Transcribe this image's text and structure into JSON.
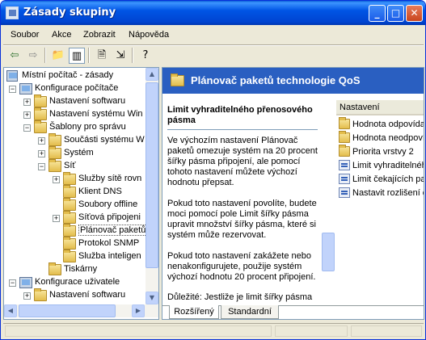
{
  "window": {
    "title": "Zásady skupiny"
  },
  "menu": [
    "Soubor",
    "Akce",
    "Zobrazit",
    "Nápověda"
  ],
  "tree": [
    {
      "label": "Místní počítač - zásady",
      "icon": "policy-icon"
    },
    {
      "label": "Konfigurace počítače",
      "icon": "computer-icon"
    },
    {
      "label": "Nastavení softwaru",
      "icon": "folder-icon"
    },
    {
      "label": "Nastavení systému Win",
      "icon": "folder-icon"
    },
    {
      "label": "Šablony pro správu",
      "icon": "folder-icon"
    },
    {
      "label": "Součásti systému W",
      "icon": "folder-icon"
    },
    {
      "label": "Systém",
      "icon": "folder-icon"
    },
    {
      "label": "Síť",
      "icon": "folder-open-icon"
    },
    {
      "label": "Služby sítě rovn",
      "icon": "folder-icon"
    },
    {
      "label": "Klient DNS",
      "icon": "folder-icon"
    },
    {
      "label": "Soubory offline",
      "icon": "folder-icon"
    },
    {
      "label": "Síťová připojeni",
      "icon": "folder-icon"
    },
    {
      "label": "Plánovač paketů",
      "icon": "folder-open-icon"
    },
    {
      "label": "Protokol SNMP",
      "icon": "folder-icon"
    },
    {
      "label": "Služba inteligen",
      "icon": "folder-icon"
    },
    {
      "label": "Tiskárny",
      "icon": "folder-icon"
    },
    {
      "label": "Konfigurace uživatele",
      "icon": "user-icon"
    },
    {
      "label": "Nastavení softwaru",
      "icon": "folder-icon"
    }
  ],
  "header": {
    "title": "Plánovač paketů technologie QoS"
  },
  "description": {
    "title": "Limit vyhraditelného přenosového pásma",
    "p1": "Ve výchozím nastavení Plánovač paketů omezuje systém na 20 procent šířky pásma připojení, ale pomocí tohoto nastavení můžete výchozí hodnotu přepsat.",
    "p2": "Pokud toto nastavení povolíte, budete moci pomocí pole Limit šířky pásma upravit množství šířky pásma, které si systém může rezervovat.",
    "p3": "Pokud toto nastavení zakážete nebo nenakonfigurujete, použije systém výchozí hodnotu 20 procent připojení.",
    "p4": "Důležité: Jestliže je limit šířky pásma"
  },
  "list": {
    "header": "Nastavení",
    "items": [
      {
        "label": "Hodnota odpovída",
        "icon": "folder-icon"
      },
      {
        "label": "Hodnota neodpoví",
        "icon": "folder-icon"
      },
      {
        "label": "Priorita vrstvy 2",
        "icon": "folder-icon"
      },
      {
        "label": "Limit vyhraditelnéh",
        "icon": "setting-icon"
      },
      {
        "label": "Limit čekajících pak",
        "icon": "setting-icon"
      },
      {
        "label": "Nastavit rozlišení č",
        "icon": "setting-icon"
      }
    ]
  },
  "tabs": [
    "Rozšířený",
    "Standardní"
  ]
}
